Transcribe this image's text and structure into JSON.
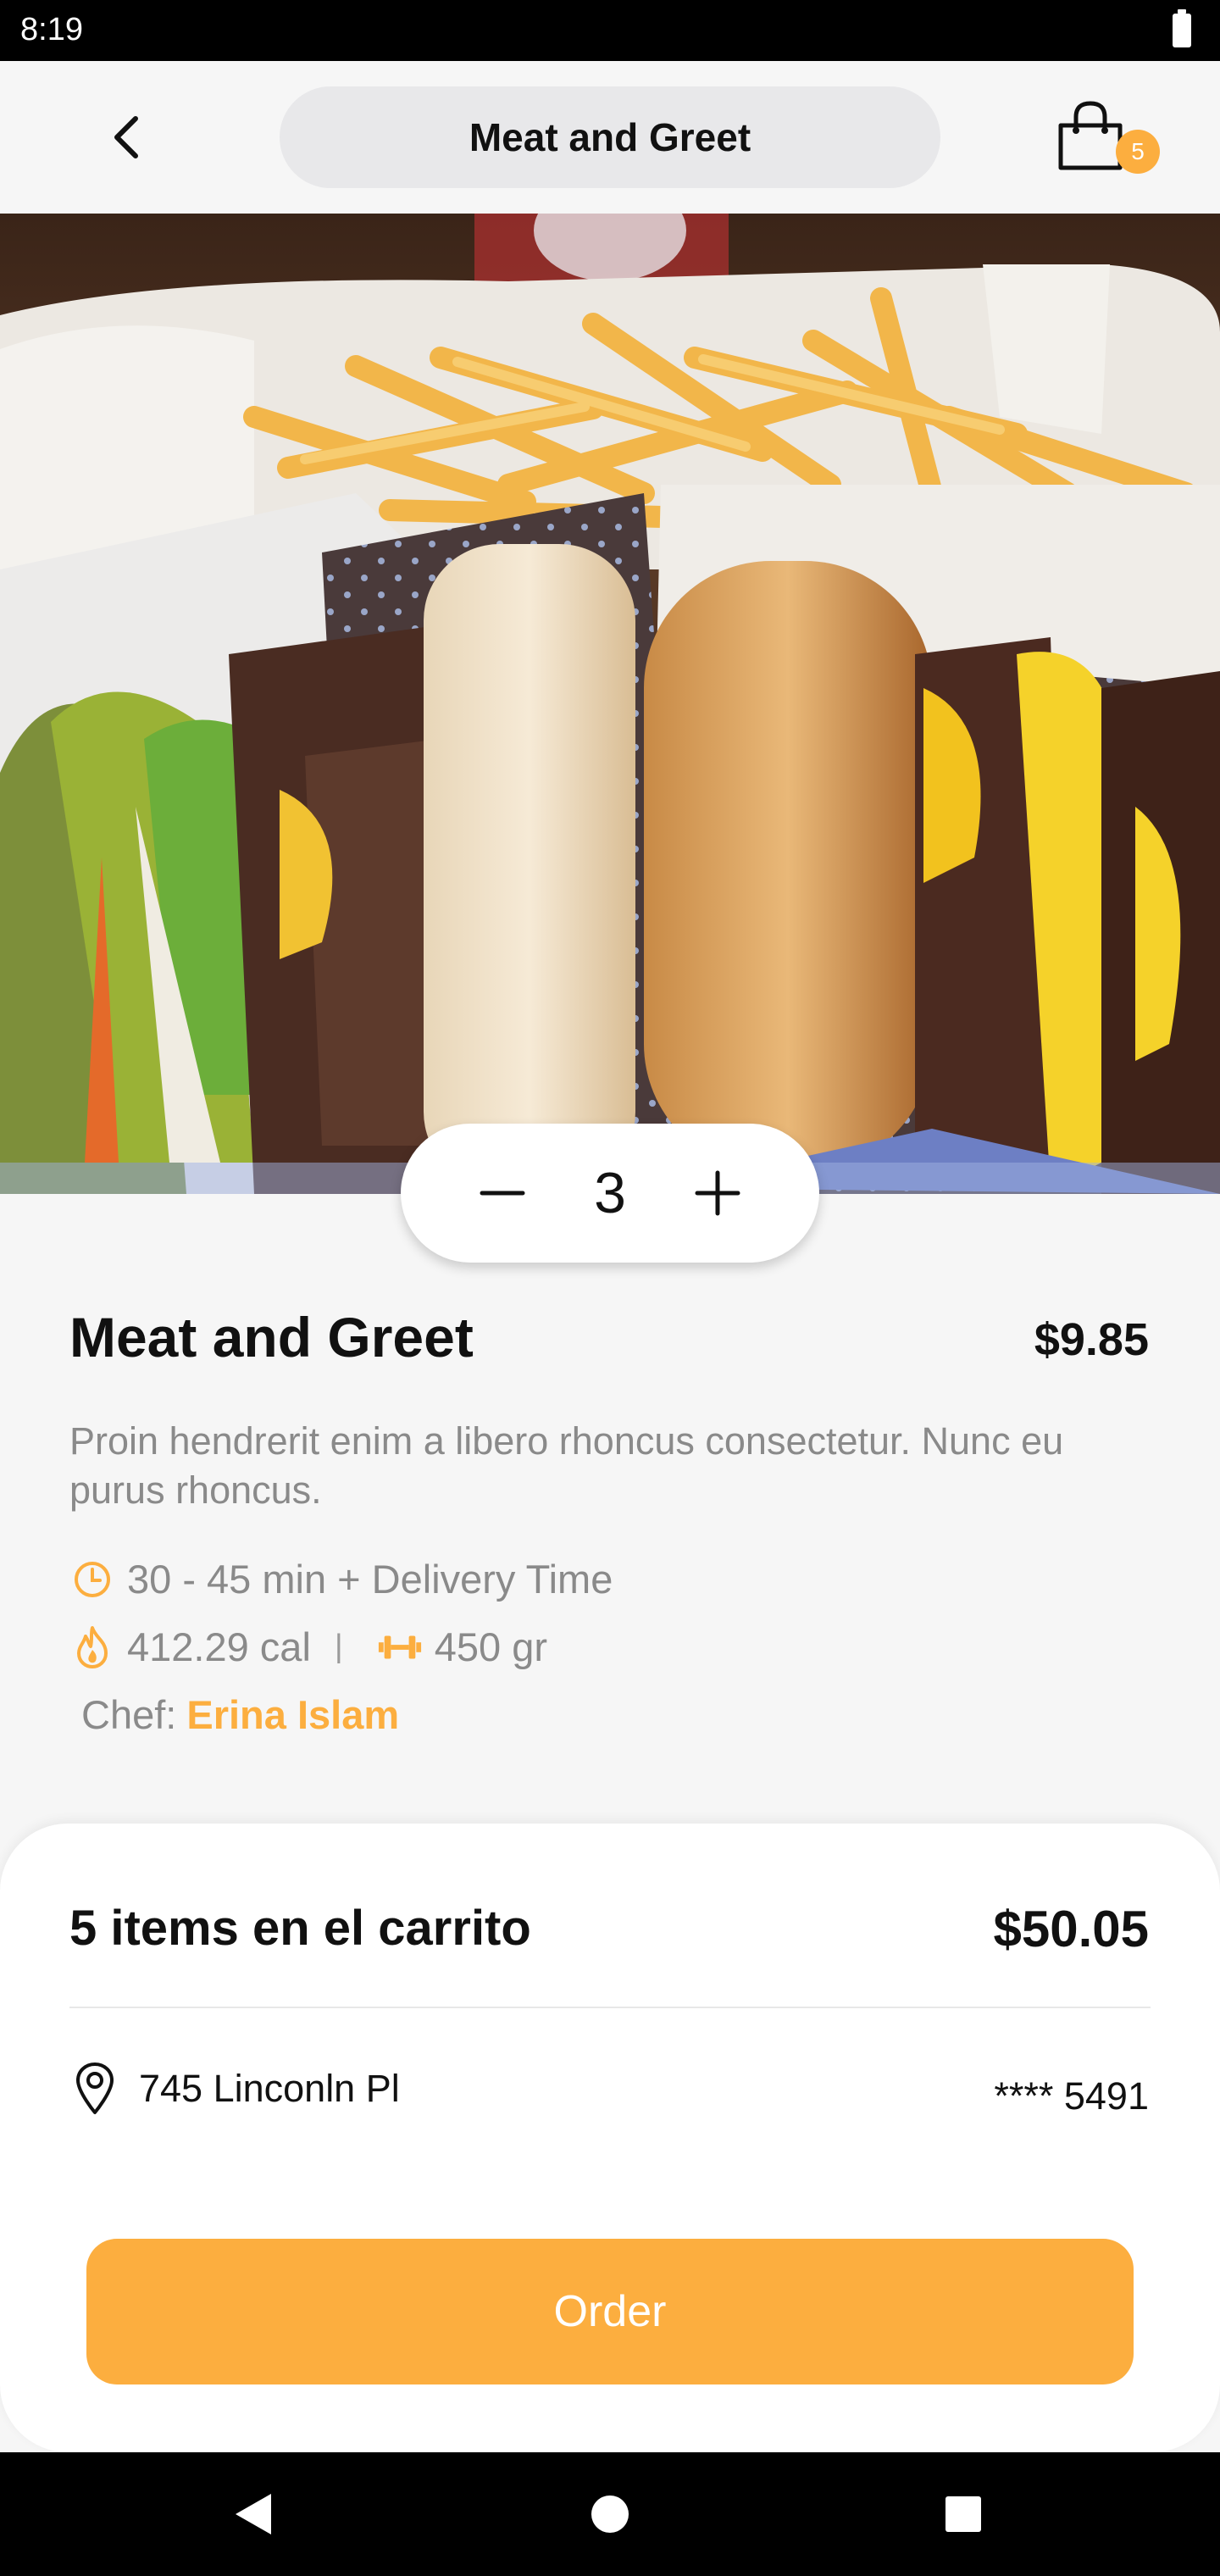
{
  "status_bar": {
    "time": "8:19"
  },
  "header": {
    "title": "Meat and Greet",
    "cart_count": "5"
  },
  "quantity": {
    "value": "3"
  },
  "product": {
    "name": "Meat and Greet",
    "price": "$9.85",
    "description": "Proin hendrerit enim a libero rhoncus consectetur. Nunc eu purus rhoncus.",
    "delivery_time": "30 - 45 min + Delivery Time",
    "calories": "412.29 cal",
    "separator": "|",
    "weight": "450 gr",
    "chef_label": "Chef:",
    "chef_name": "Erina Islam"
  },
  "cart": {
    "summary": "5 items en el carrito",
    "total": "$50.05",
    "address": "745 Linconln Pl",
    "card": "**** 5491",
    "order_label": "Order"
  },
  "icons": {
    "back": "chevron-left-icon",
    "cart": "shopping-bag-icon",
    "minus": "minus-icon",
    "plus": "plus-icon",
    "clock": "clock-icon",
    "fire": "fire-icon",
    "weight": "dumbbell-icon",
    "location": "location-pin-icon"
  },
  "colors": {
    "accent": "#fcae3f",
    "text": "#111111",
    "muted": "#8a8a8a",
    "background": "#f6f6f6"
  }
}
